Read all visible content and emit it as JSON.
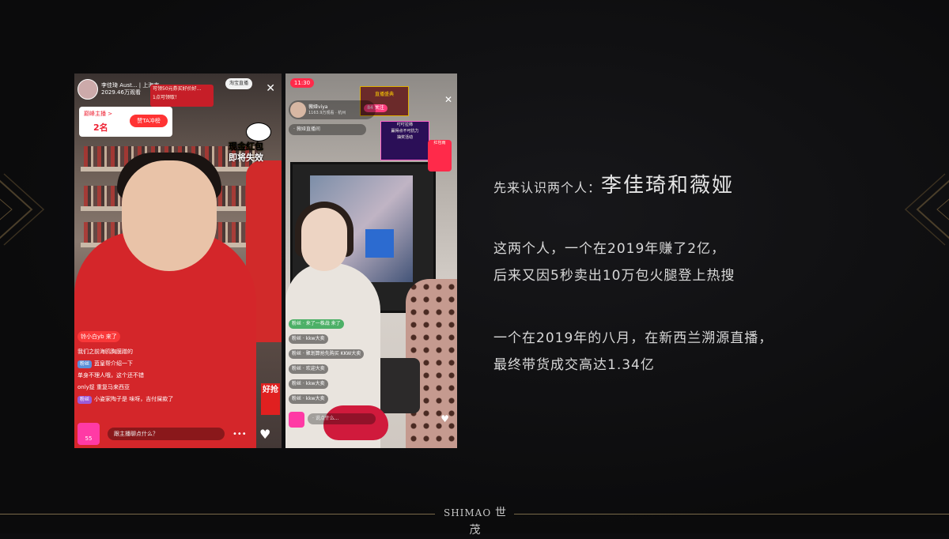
{
  "slide": {
    "intro_prefix": "先来认识两个人：",
    "intro_names": "李佳琦和薇娅",
    "para1_line1": "这两个人，一个在2019年赚了2亿，",
    "para1_line2": "后来又因5秒卖出10万包火腿登上热搜",
    "para2_line1": "一个在2019年的八月，在新西兰溯源直播，",
    "para2_line2": "最终带货成交高达1.34亿"
  },
  "footer": {
    "brand_latin": "SHIMAO",
    "brand_cn": "世茂"
  },
  "phone1": {
    "host_name": "李佳琦 Aust...",
    "host_loc": "上海市",
    "host_views": "2029.46万观看",
    "follow_label": "淘宝直播",
    "rank_title": "巅峰主播 >",
    "rank_value": "2名",
    "rank_btn": "赞TA冲榜",
    "notice_line1": "可领50元券买好价好...",
    "notice_line2": "1点可领取！",
    "badge_line1": "现金红包",
    "badge_line2": "即将失效",
    "comments": [
      {
        "badge": "",
        "text": "铃小白yb 来了",
        "highlight": true
      },
      {
        "badge": "",
        "text": "我们之前海鸥胸膜蹭的"
      },
      {
        "badge": "粉丝",
        "text": "蓝皇帮介绍一下"
      },
      {
        "badge": "",
        "text": "单身不理人哦，这个还不错"
      },
      {
        "badge": "",
        "text": "only捉  重复马来西亚"
      },
      {
        "badge": "粉丝",
        "text": "小姿家陶子是 味呀，吉付屎款了"
      }
    ],
    "ask_placeholder": "跟主播聊点什么？",
    "bag_label": "55",
    "sale_tag": "好抢"
  },
  "phone2": {
    "time": "11:30",
    "host_name": "薇娅viya",
    "host_sub": "1163.9万观看 · 杭州",
    "tag": "· 薇娅直播间",
    "banner_text": "直播盛典",
    "banner_btn": "84 关注",
    "promo_line1": "叮叮拉柿",
    "promo_line2": "赢得点不可抗力",
    "promo_line3": "抽奖活动",
    "coupon": "红包雨",
    "comments": [
      "粉丝 · 来了一株战  来了",
      "粉丝 · kkw大卖",
      "粉丝 · 聚划算抢先购买 KKW大卖",
      "粉丝 · 欢迎大卖",
      "粉丝 · kkw大卖",
      "粉丝 · kkw大卖"
    ],
    "bottom_placeholder": "· 说点什么..."
  }
}
